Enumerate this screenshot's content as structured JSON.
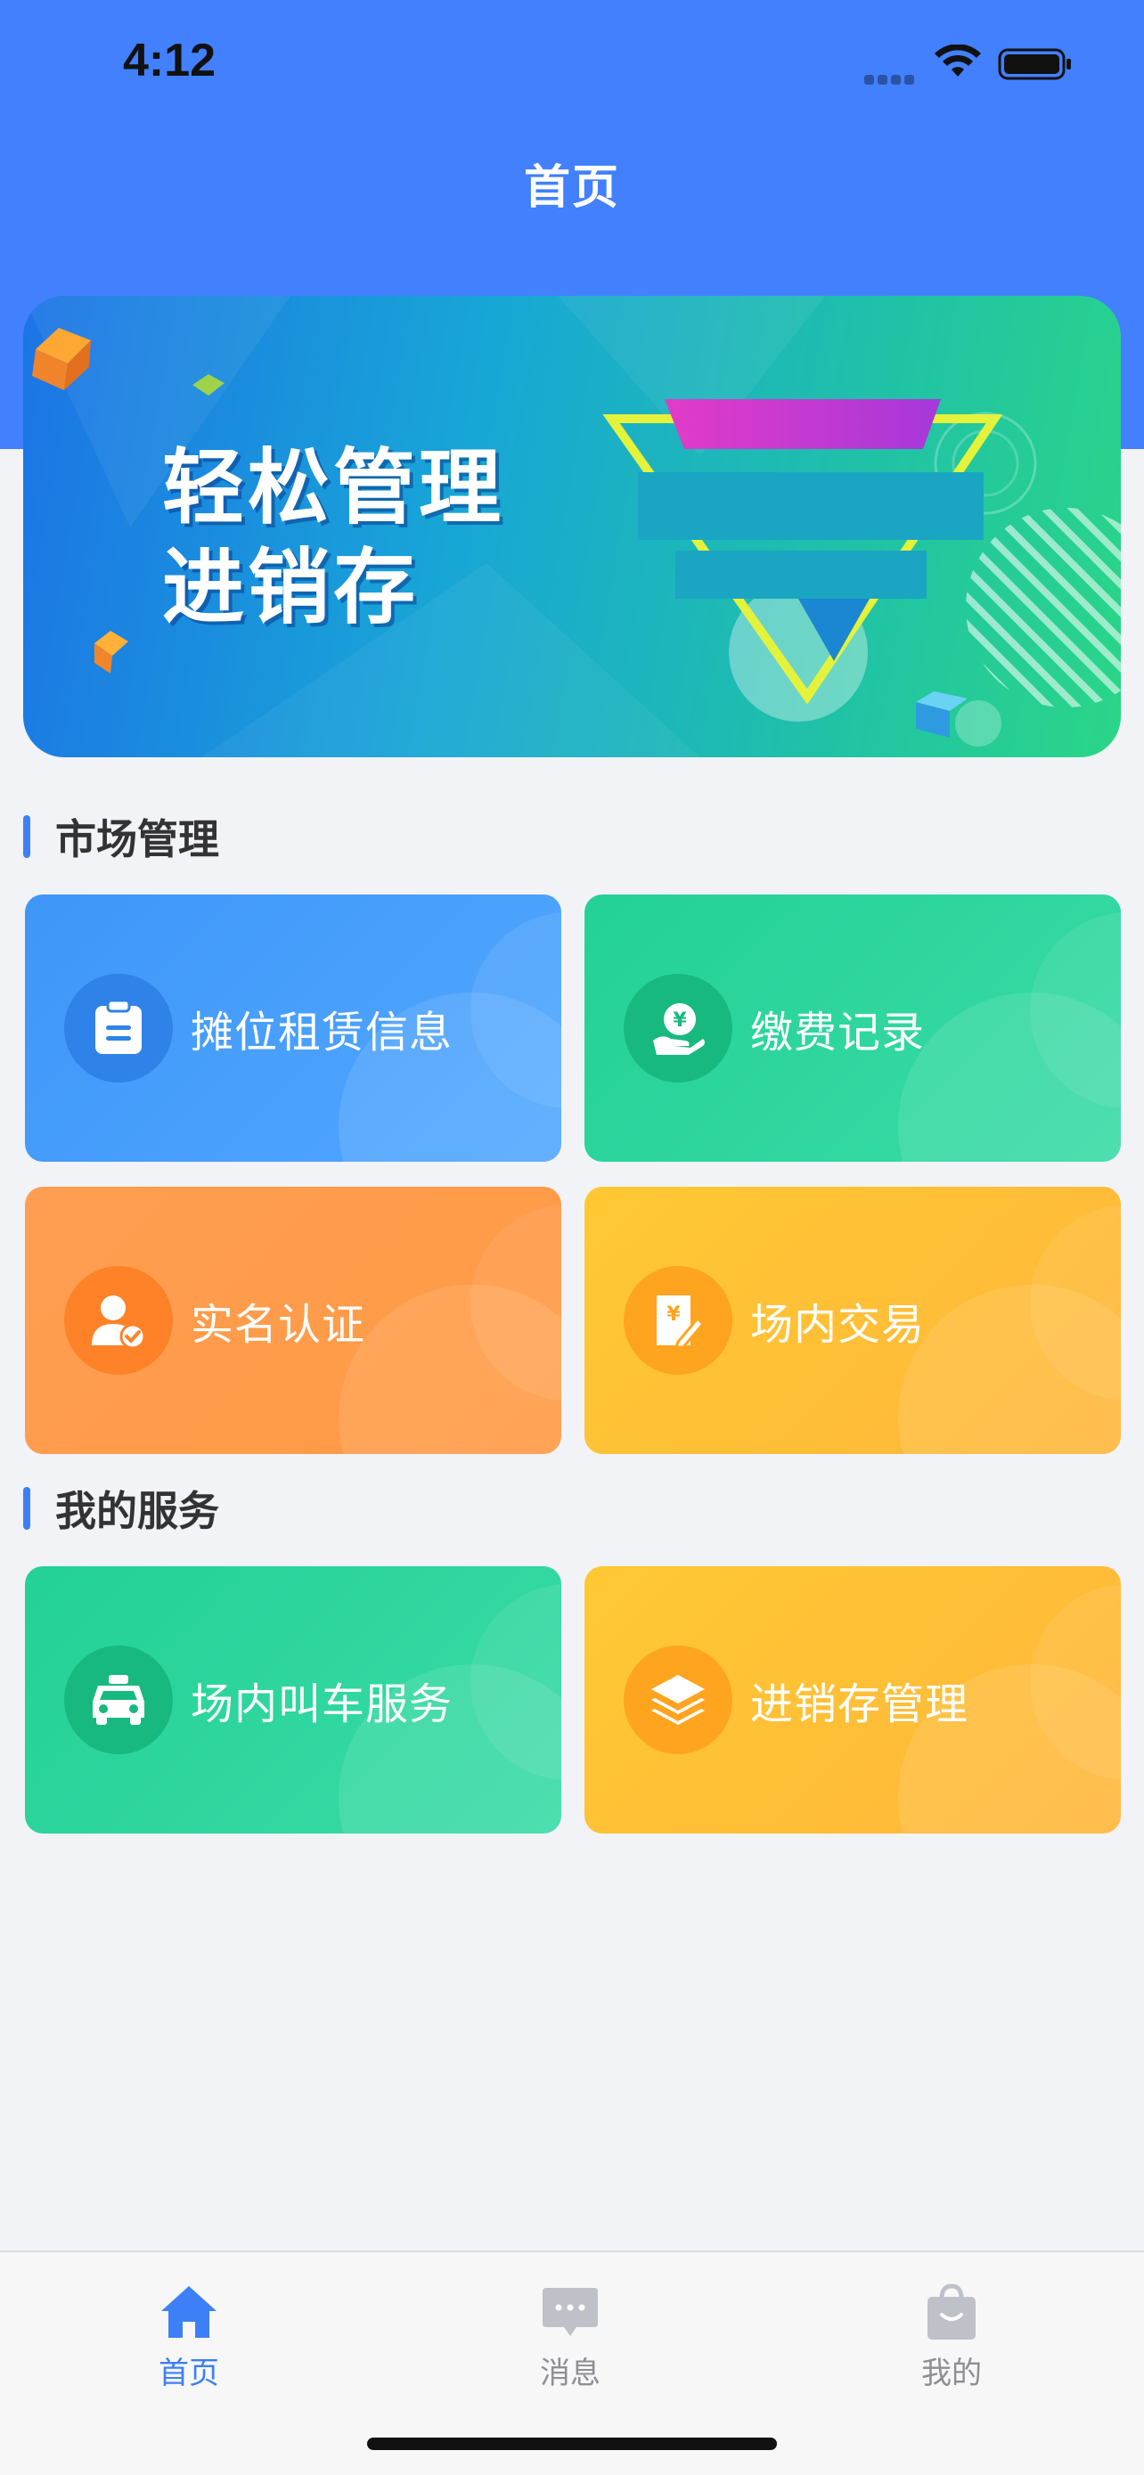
{
  "status_bar": {
    "time": "4:12"
  },
  "header": {
    "title": "首页"
  },
  "banner": {
    "line1": "轻松管理",
    "line2": "进销存"
  },
  "sections": [
    {
      "title": "市场管理",
      "cards": [
        {
          "label": "摊位租赁信息",
          "icon": "clipboard-icon",
          "color": "#3E96F8"
        },
        {
          "label": "缴费记录",
          "icon": "payment-hand-icon",
          "color": "#23D196"
        },
        {
          "label": "实名认证",
          "icon": "user-verified-icon",
          "color": "#FF9E52"
        },
        {
          "label": "场内交易",
          "icon": "receipt-edit-icon",
          "color": "#FFC933"
        }
      ]
    },
    {
      "title": "我的服务",
      "cards": [
        {
          "label": "场内叫车服务",
          "icon": "taxi-icon",
          "color": "#23D196"
        },
        {
          "label": "进销存管理",
          "icon": "layers-icon",
          "color": "#FFC933"
        }
      ]
    }
  ],
  "tabbar": {
    "items": [
      {
        "label": "首页",
        "icon": "home-icon",
        "active": true
      },
      {
        "label": "消息",
        "icon": "message-icon",
        "active": false
      },
      {
        "label": "我的",
        "icon": "shopping-bag-icon",
        "active": false
      }
    ],
    "active_color": "#3D7FF7",
    "inactive_color": "#8E8E93"
  },
  "theme": {
    "primary": "#4280FE",
    "background": "#F2F3F7"
  }
}
